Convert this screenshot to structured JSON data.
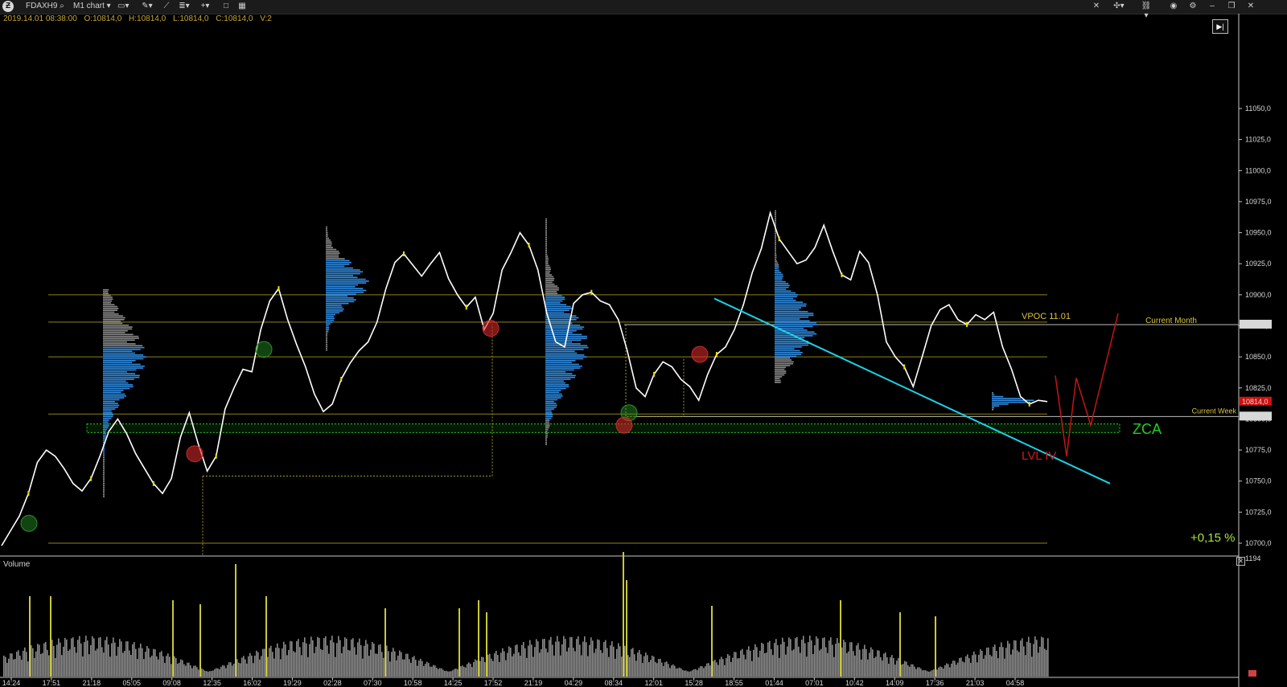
{
  "toolbar": {
    "symbol": "FDAXH9",
    "chart_type": "M1 chart",
    "icons": [
      "logo-icon",
      "search-icon",
      "monitor-icon",
      "pencil-icon",
      "line-chart-icon",
      "indicators-icon",
      "plus-icon",
      "window-icon",
      "grid-icon"
    ],
    "right_icons": [
      "tools-icon",
      "crosshair-icon",
      "link-icon",
      "camera-icon",
      "settings-icon",
      "minimize-icon",
      "restore-icon",
      "close-icon"
    ]
  },
  "ohlc": {
    "datetime": "2019.14.01 08:38:00",
    "open": "O:10814,0",
    "high": "H:10814,0",
    "low": "L:10814,0",
    "close": "C:10814,0",
    "volume": "V:2"
  },
  "colors": {
    "price": "#ffffff",
    "profile_value_area": "#2f8fe8",
    "profile_outside": "#8c8c8c",
    "level_line": "#a89a1e",
    "zone": "#1fd11f",
    "trend_line": "#19d3e6",
    "projection": "#c41515",
    "volume": "#9a9a9a",
    "volume_spike": "#c8c83a",
    "current_price_bg": "#d01010"
  },
  "chart_data": {
    "type": "line",
    "title": "",
    "ylabel": "",
    "ylim": [
      10690,
      11070
    ],
    "y_ticks": [
      "11050,0",
      "11025,0",
      "11000,0",
      "10975,0",
      "10950,0",
      "10925,0",
      "10900,0",
      "10875,0",
      "10850,0",
      "10825,0",
      "10800,0",
      "10775,0",
      "10750,0",
      "10725,0",
      "10700,0"
    ],
    "x_ticks": [
      "14:24",
      "17:51",
      "21:18",
      "05:05",
      "09:08",
      "12:35",
      "16:02",
      "19:29",
      "02:28",
      "07:30",
      "10:58",
      "14:25",
      "17:52",
      "21:19",
      "04:29",
      "08:34",
      "12:01",
      "15:28",
      "18:55",
      "01:44",
      "07:01",
      "10:42",
      "14:09",
      "17:36",
      "21:03",
      "04:58"
    ],
    "series": [
      {
        "values": [
          10698,
          10710,
          10722,
          10740,
          10765,
          10775,
          10770,
          10760,
          10748,
          10742,
          10752,
          10770,
          10790,
          10800,
          10788,
          10772,
          10760,
          10748,
          10740,
          10752,
          10785,
          10805,
          10780,
          10758,
          10770,
          10808,
          10825,
          10840,
          10838,
          10872,
          10895,
          10905,
          10880,
          10860,
          10842,
          10820,
          10806,
          10812,
          10832,
          10845,
          10855,
          10862,
          10878,
          10905,
          10926,
          10933,
          10924,
          10915,
          10925,
          10934,
          10913,
          10900,
          10890,
          10898,
          10872,
          10885,
          10920,
          10934,
          10950,
          10940,
          10920,
          10885,
          10862,
          10858,
          10893,
          10900,
          10902,
          10895,
          10892,
          10880,
          10855,
          10825,
          10818,
          10836,
          10846,
          10842,
          10832,
          10826,
          10815,
          10836,
          10852,
          10858,
          10872,
          10892,
          10918,
          10937,
          10966,
          10945,
          10935,
          10925,
          10928,
          10938,
          10956,
          10935,
          10916,
          10912,
          10935,
          10926,
          10900,
          10862,
          10850,
          10842,
          10826,
          10850,
          10875,
          10888,
          10892,
          10880,
          10876,
          10884,
          10880,
          10886,
          10858,
          10840,
          10818,
          10812,
          10815,
          10814
        ]
      }
    ],
    "level_lines": [
      {
        "price": 10900
      },
      {
        "price": 10878
      },
      {
        "price": 10850
      },
      {
        "price": 10804
      },
      {
        "price": 10700
      }
    ],
    "horizontal_labels": [
      {
        "price": 10878,
        "label": "VPOC 11.01"
      },
      {
        "price": 10876,
        "label": "Current Month",
        "value": "10875,0"
      },
      {
        "price": 10802,
        "label": "Current Week",
        "value": "10803,0"
      }
    ],
    "current_price": "10814,0",
    "zone": {
      "from": 10789,
      "to": 10796,
      "label": "ZCA"
    },
    "trend_line": {
      "from": 10897,
      "to": 10748
    },
    "projection_label": "LVL IV",
    "change_label": "+0,15 %",
    "buy_markers": [
      10716,
      10856,
      10805
    ],
    "sell_markers": [
      10772,
      10873,
      10795,
      10852
    ],
    "volume": {
      "label": "Volume",
      "max_tick": "1194"
    }
  }
}
